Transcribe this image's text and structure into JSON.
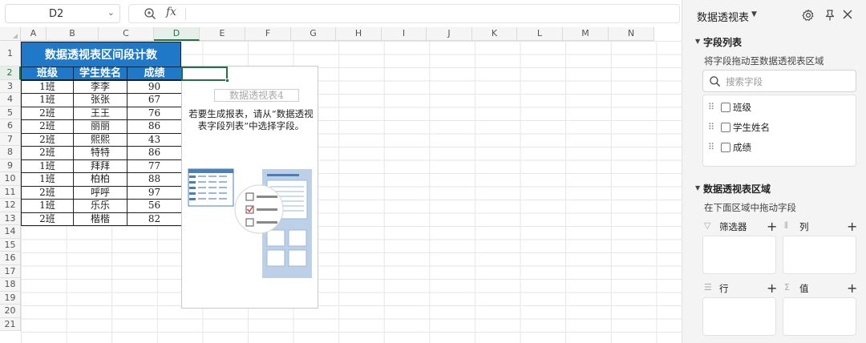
{
  "formula_bar": {
    "name_box": "D2",
    "fx_label": "fx",
    "formula": ""
  },
  "grid": {
    "columns": [
      "A",
      "B",
      "C",
      "D",
      "E",
      "F",
      "G",
      "H",
      "I",
      "J",
      "K",
      "L",
      "M",
      "N"
    ],
    "rows": [
      "1",
      "2",
      "3",
      "4",
      "5",
      "6",
      "7",
      "8",
      "9",
      "10",
      "11",
      "12",
      "13",
      "14",
      "15",
      "16",
      "17",
      "18",
      "19",
      "20",
      "21"
    ],
    "selected_column": "D",
    "selected_row": "2"
  },
  "table": {
    "title": "数据透视表区间段计数",
    "headers": [
      "班级",
      "学生姓名",
      "成绩"
    ],
    "rows": [
      [
        "1班",
        "李李",
        "90"
      ],
      [
        "1班",
        "张张",
        "67"
      ],
      [
        "2班",
        "王王",
        "76"
      ],
      [
        "2班",
        "丽丽",
        "86"
      ],
      [
        "2班",
        "熙熙",
        "43"
      ],
      [
        "2班",
        "特特",
        "86"
      ],
      [
        "1班",
        "拜拜",
        "77"
      ],
      [
        "1班",
        "柏柏",
        "88"
      ],
      [
        "2班",
        "呼呼",
        "97"
      ],
      [
        "1班",
        "乐乐",
        "56"
      ],
      [
        "2班",
        "楷楷",
        "82"
      ]
    ],
    "header_color": "#1f78c8"
  },
  "pivot_placeholder": {
    "name": "数据透视表4",
    "message": "若要生成报表，请从“数据透视表字段列表”中选择字段。"
  },
  "panel": {
    "title": "数据透视表",
    "field_list": {
      "heading": "字段列表",
      "note": "将字段拖动至数据透视表区域",
      "search_placeholder": "搜索字段",
      "fields": [
        "班级",
        "学生姓名",
        "成绩"
      ]
    },
    "areas": {
      "heading": "数据透视表区域",
      "note": "在下面区域中拖动字段",
      "filter": "筛选器",
      "columns": "列",
      "rows": "行",
      "values": "值"
    }
  },
  "colors": {
    "accent_green": "#217346",
    "header_blue": "#1f78c8",
    "panel_bg": "#f4f4f4"
  }
}
